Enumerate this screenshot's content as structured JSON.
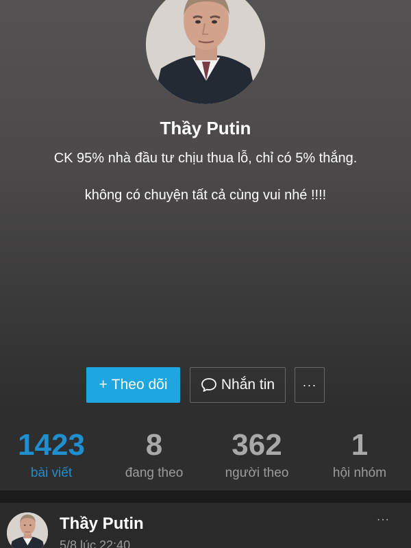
{
  "profile": {
    "name": "Thầy Putin",
    "bio": "CK 95% nhà đầu tư chịu thua lỗ, chỉ có 5% thắng.\n\nkhông có chuyện tất cả cùng vui nhé !!!!"
  },
  "actions": {
    "follow_icon": "+",
    "follow_label": "Theo dõi",
    "message_icon": "speech-bubble-icon",
    "message_label": "Nhắn tin",
    "more_label": "···"
  },
  "stats": [
    {
      "value": "1423",
      "label": "bài viết",
      "active": true
    },
    {
      "value": "8",
      "label": "đang theo",
      "active": false
    },
    {
      "value": "362",
      "label": "người theo",
      "active": false
    },
    {
      "value": "1",
      "label": "hội nhóm",
      "active": false
    }
  ],
  "post": {
    "author": "Thầy Putin",
    "time": "5/8 lúc 22:40",
    "more_label": "···"
  },
  "colors": {
    "accent": "#1ea6e1",
    "active_stat": "#1f8fd0",
    "background": "#1b1b1c"
  }
}
